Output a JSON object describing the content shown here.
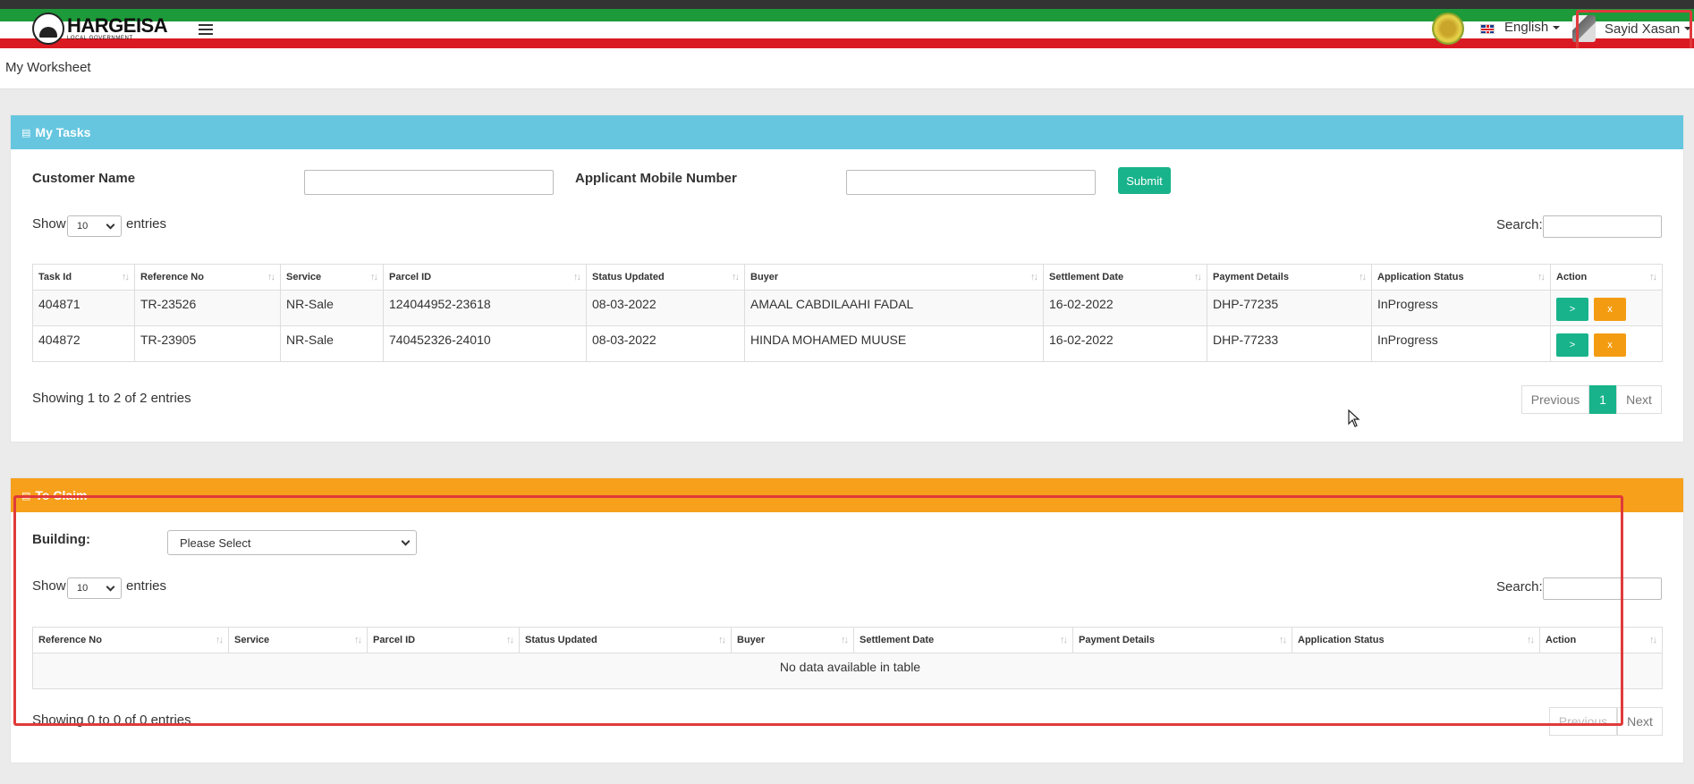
{
  "header": {
    "logo_title": "HARGEISA",
    "logo_sub": "LOCAL GOVERNMENT",
    "language": "English",
    "user_name": "Sayid Xasan"
  },
  "page": {
    "title": "My Worksheet"
  },
  "tasks": {
    "title": "My Tasks",
    "customer_name_label": "Customer Name",
    "mobile_label": "Applicant Mobile Number",
    "submit_label": "Submit",
    "show_label": "Show",
    "entries_label": "entries",
    "page_size": "10",
    "search_label": "Search:",
    "columns": [
      "Task Id",
      "Reference No",
      "Service",
      "Parcel ID",
      "Status Updated",
      "Buyer",
      "Settlement Date",
      "Payment Details",
      "Application Status",
      "Action"
    ],
    "rows": [
      {
        "task_id": "404871",
        "reference_no": "TR-23526",
        "service": "NR-Sale",
        "parcel_id": "124044952-23618",
        "status_updated": "08-03-2022",
        "buyer": "AMAAL CABDILAAHI FADAL",
        "settlement_date": "16-02-2022",
        "payment_details": "DHP-77235",
        "application_status": "InProgress"
      },
      {
        "task_id": "404872",
        "reference_no": "TR-23905",
        "service": "NR-Sale",
        "parcel_id": "740452326-24010",
        "status_updated": "08-03-2022",
        "buyer": "HINDA MOHAMED MUUSE",
        "settlement_date": "16-02-2022",
        "payment_details": "DHP-77233",
        "application_status": "InProgress"
      }
    ],
    "action_go": ">",
    "action_x": "x",
    "info": "Showing 1 to 2 of 2 entries",
    "pager": {
      "previous": "Previous",
      "current": "1",
      "next": "Next"
    }
  },
  "claim": {
    "title": "To Claim",
    "building_label": "Building:",
    "building_value": "Please Select",
    "show_label": "Show",
    "entries_label": "entries",
    "page_size": "10",
    "search_label": "Search:",
    "columns": [
      "Reference No",
      "Service",
      "Parcel ID",
      "Status Updated",
      "Buyer",
      "Settlement Date",
      "Payment Details",
      "Application Status",
      "Action"
    ],
    "empty": "No data available in table",
    "info": "Showing 0 to 0 of 0 entries",
    "pager": {
      "previous": "Previous",
      "next": "Next"
    }
  },
  "colors": {
    "tasks_header": "#66c6e0",
    "claim_header": "#f6a01b",
    "accent": "#18b38b",
    "warn": "#f39c12",
    "highlight": "#e03a3a"
  }
}
